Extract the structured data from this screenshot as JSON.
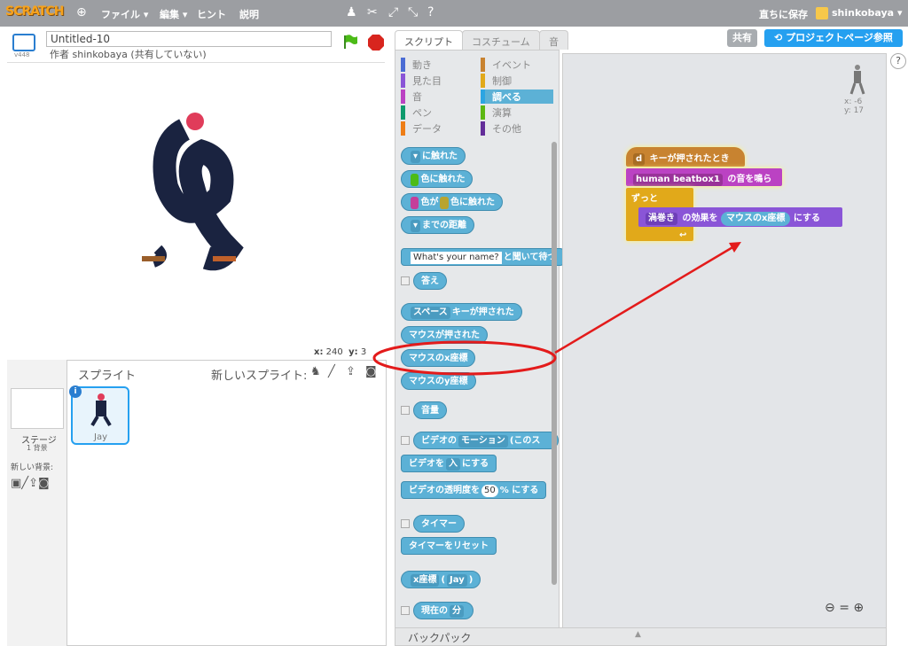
{
  "menubar": {
    "logo": "SCRATCH",
    "file": "ファイル ▾",
    "edit": "編集 ▾",
    "tips": "ヒント",
    "about": "説明",
    "save_now": "直ちに保存",
    "user": "shinkobaya ▾"
  },
  "project": {
    "title": "Untitled-10",
    "author": "作者 shinkobaya (共有していない)",
    "version": "v448"
  },
  "stage": {
    "x_label": "x:",
    "x_value": "240",
    "y_label": "y:",
    "y_value": "3"
  },
  "sprites": {
    "title": "スプライト",
    "new_sprite": "新しいスプライト:",
    "stage_label": "ステージ",
    "bg_count": "1 背景",
    "new_bg": "新しい背景:",
    "selected": "Jay"
  },
  "tabs": [
    "スクリプト",
    "コスチューム",
    "音"
  ],
  "categories": [
    {
      "label": "動き",
      "color": "#4a6cd4"
    },
    {
      "label": "イベント",
      "color": "#c88330"
    },
    {
      "label": "見た目",
      "color": "#8a55d7"
    },
    {
      "label": "制御",
      "color": "#e1a91a"
    },
    {
      "label": "音",
      "color": "#bb42c3"
    },
    {
      "label": "調べる",
      "color": "#2ca5e2"
    },
    {
      "label": "ペン",
      "color": "#0e9a6c"
    },
    {
      "label": "演算",
      "color": "#5cb712"
    },
    {
      "label": "データ",
      "color": "#ee7d16"
    },
    {
      "label": "その他",
      "color": "#632d99"
    }
  ],
  "palette": {
    "touching": "に触れた",
    "touching_color": "色に触れた",
    "color_is": "色が",
    "color_touching": "色に触れた",
    "distance": "までの距離",
    "ask_default": "What's your name?",
    "ask": "と聞いて待つ",
    "answer": "答え",
    "key": "スペース",
    "key_pressed": "キーが押された",
    "mouse_down": "マウスが押された",
    "mouse_x": "マウスのx座標",
    "mouse_y": "マウスのy座標",
    "loudness": "音量",
    "video": "ビデオの",
    "motion": "モーション",
    "on": "このス",
    "video_turn": "ビデオを",
    "video_state": "入",
    "video_turn_end": "にする",
    "transparency": "ビデオの透明度を",
    "transparency_val": "50",
    "transparency_end": "% にする",
    "timer": "タイマー",
    "reset_timer": "タイマーをリセット",
    "x_pos": "x座標",
    "of_sprite": "Jay",
    "current": "現在の",
    "minute": "分"
  },
  "toolbar": {
    "share": "共有",
    "see_project": "プロジェクトページ参照"
  },
  "script": {
    "hat_key": "d",
    "hat_text": "キーが押されたとき",
    "sound": "human beatbox1",
    "sound_text": "の音を鳴らす",
    "forever": "ずっと",
    "effect": "渦巻き",
    "effect_text": "の効果を",
    "effect_value": "マウスのx座標",
    "effect_end": "にする"
  },
  "sprite_info": {
    "x": "x: -6",
    "y": "y: 17"
  },
  "backpack": "バックパック",
  "colors": {
    "accent": "#25a0f0",
    "annotation": "#e31b1b"
  }
}
